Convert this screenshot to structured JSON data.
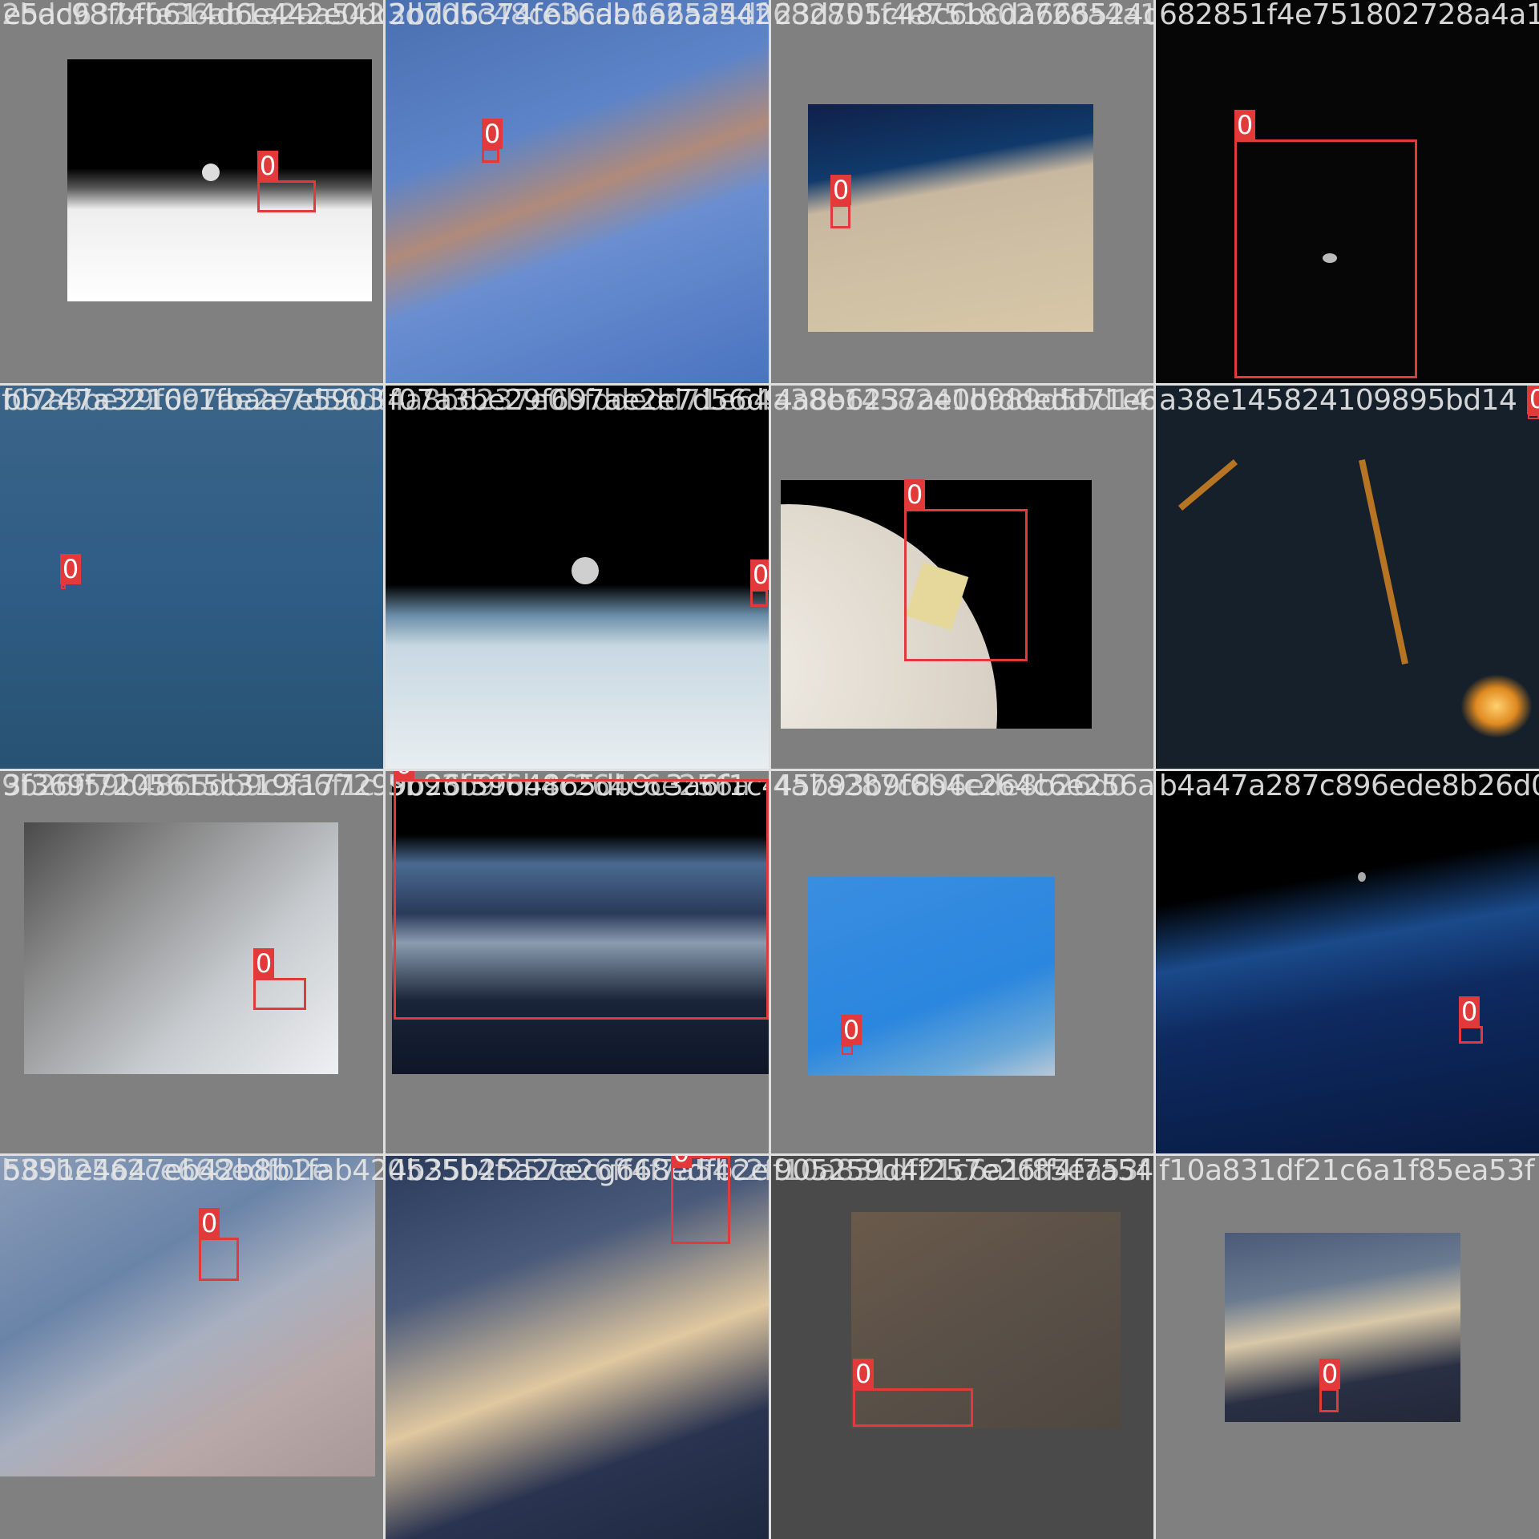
{
  "tiles": [
    {
      "name_a": "e5ac98fbfb614d6e442e0dcc",
      "name_b": "2bdd6374fe36ab1a2aa5422",
      "label": "0"
    },
    {
      "name_a": "2bdd6374fe36ab1a2aa54222",
      "name_b": "3d705c48c6bcda666524dfd",
      "label": "0"
    },
    {
      "name_a": "23d705c48c6bcda666524dfd",
      "name_b": "682851f4e751802728a4a1",
      "label": "0"
    },
    {
      "name_a": "682851f4e751802728a4a1",
      "name_b": "",
      "label": "0"
    },
    {
      "name_a": "bb247a3210c1fbaa7e590326",
      "name_b": "f07a3be29f697ae2e7d56d9",
      "label": "0"
    },
    {
      "name_a": "f07a3be29f697ae2e7d56d976",
      "name_b": "4a8b6237e0bfddedd71e64",
      "label": "0"
    },
    {
      "name_a": "4a8b6237ae0bfddedd71e64",
      "name_b": "a38e1458241d989d5bd14",
      "label": "0"
    },
    {
      "name_a": "a38e145824109895bd14",
      "name_b": "",
      "label": "0"
    },
    {
      "name_a": "3f369f7205615c319f177298",
      "name_b": "9b26f59b4865db9c3a6f1c",
      "label": "0"
    },
    {
      "name_a": "9b26f59b4865db9c3a6f1c4",
      "name_b": "5b93b9f6b4c264c6e256a",
      "label": "0"
    },
    {
      "name_a": "45b93b9f6b4c264c6e256ab",
      "name_b": "4a7a287c896ede8b26d0",
      "label": "0"
    },
    {
      "name_a": "b4a47a287c896ede8b26d0",
      "name_b": "",
      "label": "0"
    },
    {
      "name_a": "5891e4647eb42b8b1fab4218",
      "name_b": "b35b25a2ce668edfb2e",
      "label": "0"
    },
    {
      "name_a": "4b35b25a2cecg668edfb2e",
      "name_b": "0525b4f257e26ff4f7a54c2f4",
      "label": "0"
    },
    {
      "name_a": "905259d4f257e26ff4f7a54c2f4",
      "name_b": "f10a831df21c6a1f85ea53f",
      "label": "0"
    },
    {
      "name_a": "f10a831df21c6a1f85ea53f",
      "name_b": "",
      "label": "0"
    }
  ]
}
